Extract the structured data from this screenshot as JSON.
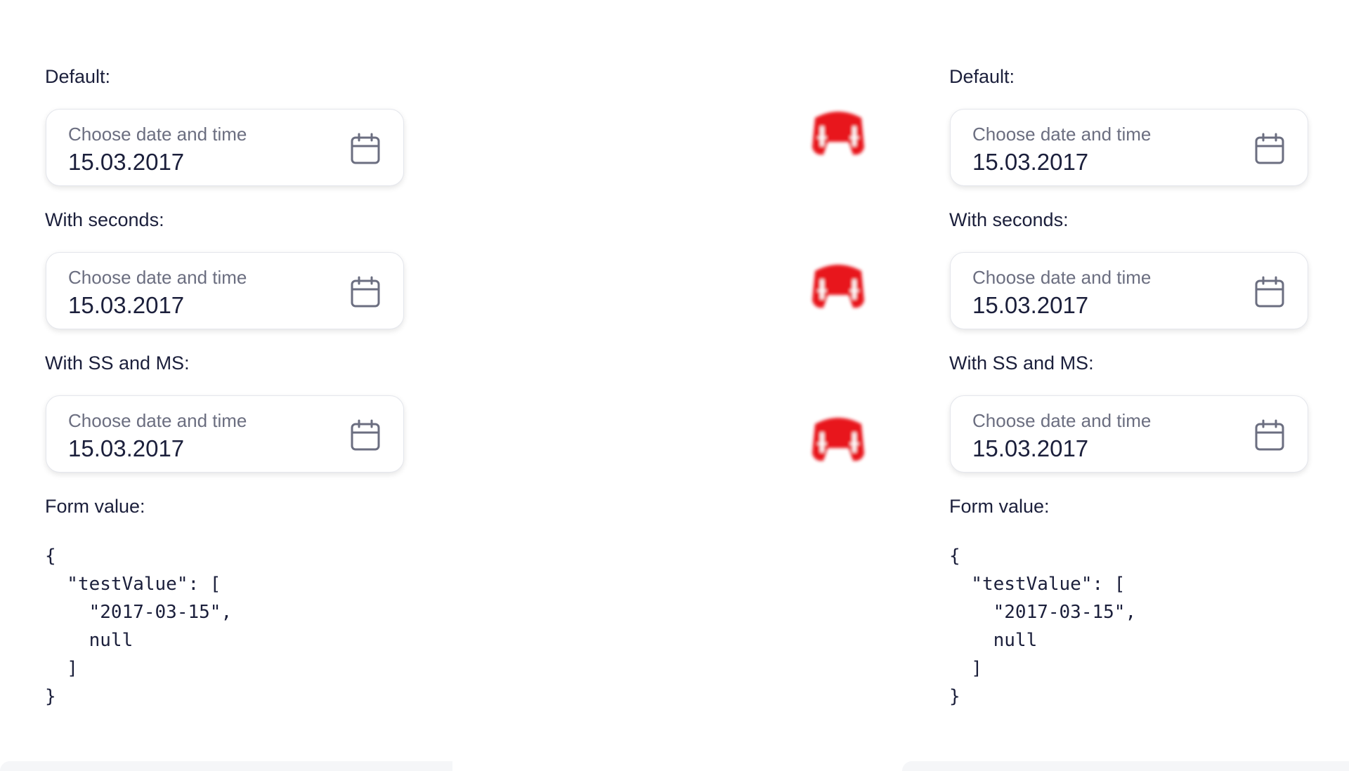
{
  "left_panel": {
    "sections": [
      {
        "label": "Default:",
        "field_label": "Choose date and time",
        "value": "15.03.2017",
        "icon": "calendar-icon"
      },
      {
        "label": "With seconds:",
        "field_label": "Choose date and time",
        "value": "15.03.2017",
        "icon": "calendar-icon"
      },
      {
        "label": "With SS and MS:",
        "field_label": "Choose date and time",
        "value": "15.03.2017",
        "icon": "calendar-icon"
      }
    ],
    "form_value_label": "Form value:",
    "form_value_json": "{\n  \"testValue\": [\n    \"2017-03-15\",\n    null\n  ]\n}"
  },
  "right_panel": {
    "sections": [
      {
        "label": "Default:",
        "field_label": "Choose date and time",
        "value": "15.03.2017",
        "icon": "calendar-icon"
      },
      {
        "label": "With seconds:",
        "field_label": "Choose date and time",
        "value": "15.03.2017",
        "icon": "calendar-icon"
      },
      {
        "label": "With SS and MS:",
        "field_label": "Choose date and time",
        "value": "15.03.2017",
        "icon": "calendar-icon"
      }
    ],
    "form_value_label": "Form value:",
    "form_value_json": "{\n  \"testValue\": [\n    \"2017-03-15\",\n    null\n  ]\n}"
  },
  "markers": {
    "icon": "red-glitch-marker-icon",
    "color": "#e8141c"
  },
  "colors": {
    "text": "#1b1f3b",
    "placeholder": "#6b6e80",
    "border": "#e4e6ec",
    "icon": "#6b6e80"
  }
}
